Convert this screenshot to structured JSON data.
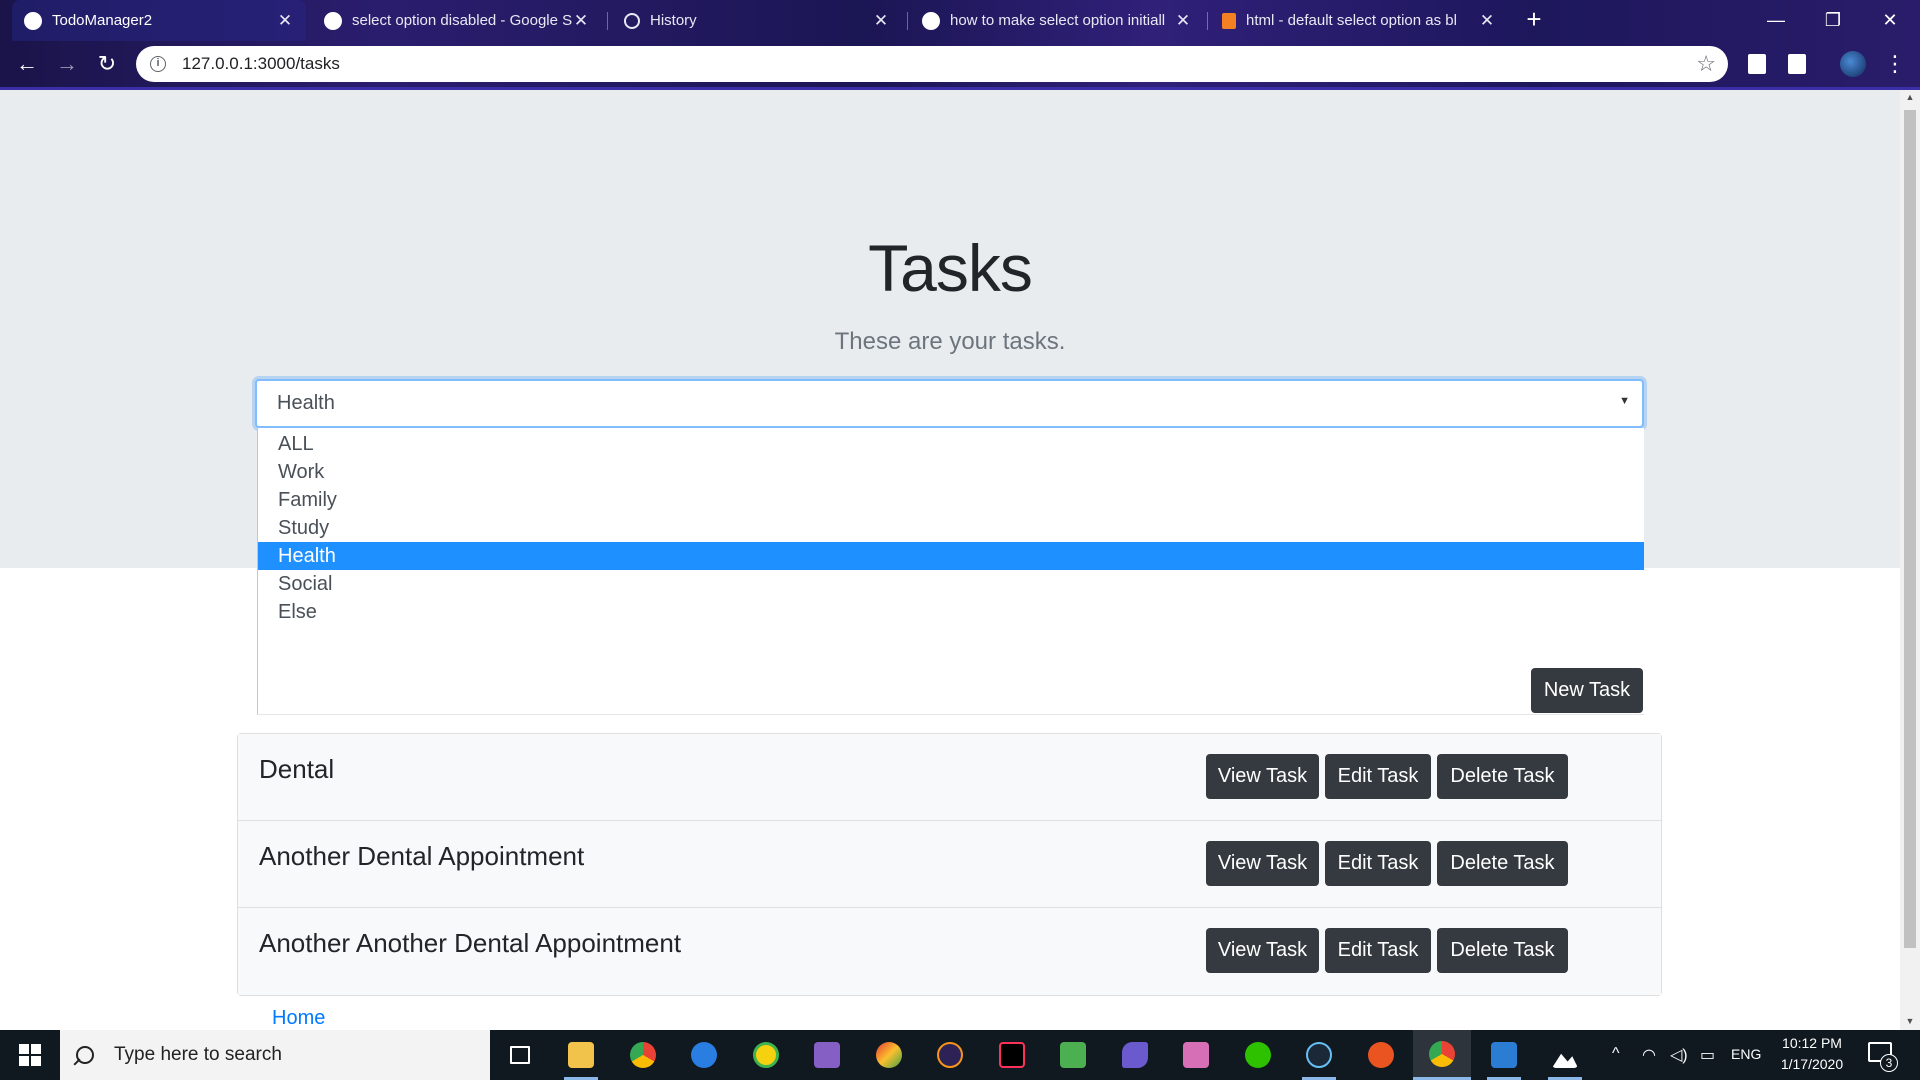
{
  "browser": {
    "tabs": [
      {
        "title": "TodoManager2",
        "icon": "chrome-favicon",
        "active": true
      },
      {
        "title": "select option disabled - Google S",
        "icon": "google-favicon",
        "active": false
      },
      {
        "title": "History",
        "icon": "history-icon",
        "active": false
      },
      {
        "title": "how to make select option initiall",
        "icon": "google-favicon",
        "active": false
      },
      {
        "title": "html - default select option as bl",
        "icon": "stackoverflow-favicon",
        "active": false
      }
    ],
    "url": "127.0.0.1:3000/tasks"
  },
  "page": {
    "title": "Tasks",
    "subtitle": "These are your tasks.",
    "category_select": {
      "selected": "Health",
      "options": [
        "ALL",
        "Work",
        "Family",
        "Study",
        "Health",
        "Social",
        "Else"
      ],
      "highlighted_index": 4
    },
    "new_task_label": "New Task",
    "tasks": [
      {
        "name": "Dental",
        "view_label": "View Task",
        "edit_label": "Edit Task",
        "delete_label": "Delete Task"
      },
      {
        "name": "Another Dental Appointment",
        "view_label": "View Task",
        "edit_label": "Edit Task",
        "delete_label": "Delete Task"
      },
      {
        "name": "Another Another Dental Appointment",
        "view_label": "View Task",
        "edit_label": "Edit Task",
        "delete_label": "Delete Task"
      }
    ],
    "home_link": "Home"
  },
  "taskbar": {
    "search_placeholder": "Type here to search",
    "language": "ENG",
    "time": "10:12 PM",
    "date": "1/17/2020",
    "notification_count": "3"
  },
  "colors": {
    "jumbotron": "#e9ecef",
    "button_dark": "#343a40",
    "selected_option": "#1e90ff",
    "link": "#007bff"
  }
}
